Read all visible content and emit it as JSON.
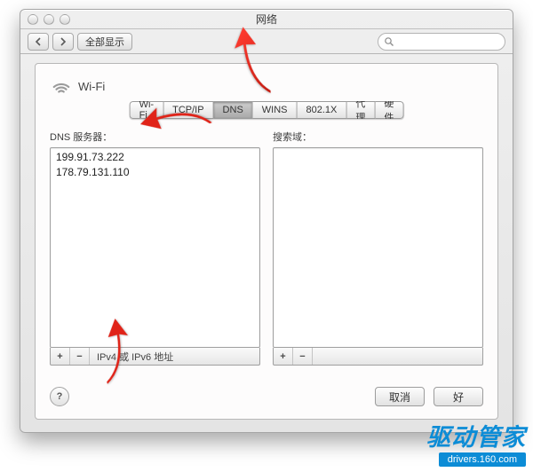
{
  "window": {
    "title": "网络"
  },
  "toolbar": {
    "show_all": "全部显示"
  },
  "service": {
    "name": "Wi-Fi"
  },
  "tabs": [
    "Wi-Fi",
    "TCP/IP",
    "DNS",
    "WINS",
    "802.1X",
    "代理",
    "硬件"
  ],
  "dns": {
    "title": "DNS 服务器：",
    "servers": [
      "199.91.73.222",
      "178.79.131.110"
    ],
    "hint": "IPv4 或 IPv6 地址"
  },
  "search_domains": {
    "title": "搜索域："
  },
  "buttons": {
    "cancel": "取消",
    "ok": "好"
  },
  "watermark": {
    "big": "驱动管家",
    "url": "drivers.160.com"
  }
}
